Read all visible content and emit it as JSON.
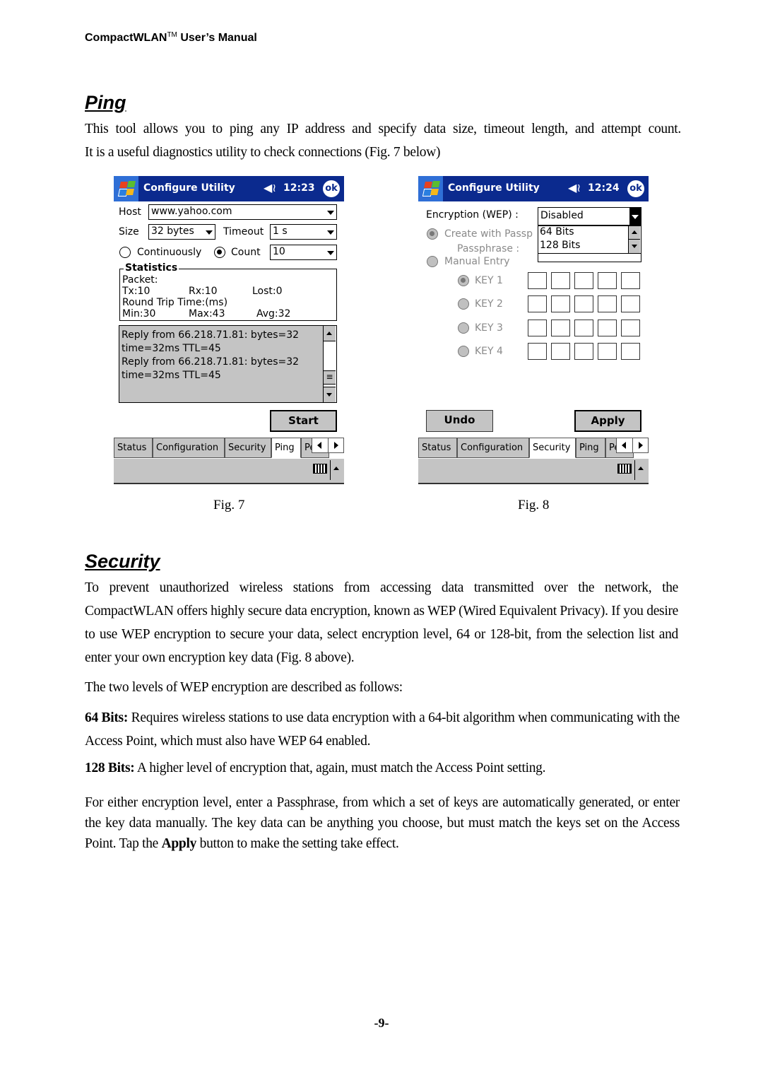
{
  "header": {
    "running_title": "CompactWLAN",
    "trademark": "TM",
    "running_title_suffix": " User’s Manual"
  },
  "ping_section": {
    "title": "Ping",
    "intro_line1": "This tool allows you to ping any IP address and specify data size, timeout length, and attempt count.",
    "intro_line2": "It is a useful diagnostics utility to check connections (Fig. 7 below)"
  },
  "fig7": {
    "caption": "Fig. 7",
    "titlebar": {
      "title": "Configure Utility",
      "time": "12:23",
      "ok_label": "ok",
      "speaker_icon": "speaker-icon"
    },
    "host_label": "Host",
    "host_value": "www.yahoo.com",
    "size_label": "Size",
    "size_value": "32 bytes",
    "timeout_label": "Timeout",
    "timeout_value": "1 s",
    "continuously_label": "Continuously",
    "continuously_selected": false,
    "count_label": "Count",
    "count_selected": true,
    "count_value": "10",
    "statistics": {
      "legend": "Statistics",
      "packet_label": "Packet:",
      "tx": "Tx:10",
      "rx": "Rx:10",
      "lost": "Lost:0",
      "rtt_label": "Round Trip Time:(ms)",
      "min": "Min:30",
      "max": "Max:43",
      "avg": "Avg:32"
    },
    "log_lines": [
      "Reply from 66.218.71.81: bytes=32",
      "time=32ms TTL=45",
      "Reply from 66.218.71.81: bytes=32",
      "time=32ms TTL=45"
    ],
    "start_button": "Start",
    "tabs": [
      {
        "label": "Status",
        "active": false
      },
      {
        "label": "Configuration",
        "active": false
      },
      {
        "label": "Security",
        "active": false
      },
      {
        "label": "Ping",
        "active": true
      },
      {
        "label": "Pe",
        "active": false
      }
    ]
  },
  "fig8": {
    "caption": "Fig. 8",
    "titlebar": {
      "title": "Configure Utility",
      "time": "12:24",
      "ok_label": "ok",
      "speaker_icon": "speaker-icon"
    },
    "encryption_label": "Encryption (WEP) :",
    "encryption_value": "Disabled",
    "encryption_options": [
      "64 Bits",
      "128 Bits"
    ],
    "create_with_passphrase_label": "Create with Passp",
    "passphrase_label": "Passphrase :",
    "manual_entry_label": "Manual Entry",
    "keys": [
      {
        "label": "KEY 1",
        "selected": true
      },
      {
        "label": "KEY 2",
        "selected": false
      },
      {
        "label": "KEY 3",
        "selected": false
      },
      {
        "label": "KEY 4",
        "selected": false
      }
    ],
    "undo_button": "Undo",
    "apply_button": "Apply",
    "tabs": [
      {
        "label": "Status",
        "active": false
      },
      {
        "label": "Configuration",
        "active": false
      },
      {
        "label": "Security",
        "active": true
      },
      {
        "label": "Ping",
        "active": false
      },
      {
        "label": "Pe",
        "active": false
      }
    ]
  },
  "security_section": {
    "title": "Security",
    "para1": "To prevent unauthorized wireless stations from accessing data transmitted over the network, the CompactWLAN offers highly secure data encryption, known as WEP (Wired Equivalent Privacy).   If you desire to use WEP encryption to secure your data, select encryption level, 64 or 128-bit, from the selection list and enter your own encryption key data (Fig. 8 above).",
    "para2": "The two levels of WEP encryption are described as follows:",
    "bits64_term": "64 Bits:",
    "bits64_desc": " Requires wireless stations to use data encryption with a 64-bit algorithm when communicating with the Access Point, which must also have WEP 64 enabled.",
    "bits128_term": "128 Bits:",
    "bits128_desc": " A higher level of encryption that, again, must match the Access Point setting.",
    "para_final_pre": "For either encryption level, enter a Passphrase, from which a set of keys are automatically generated, or enter the key data manually.  The key data can be anything you choose, but must match the keys set on the Access Point.  Tap the ",
    "para_final_bold": "Apply",
    "para_final_post": " button to make the setting take effect."
  },
  "footer": {
    "page_number": "-9-"
  }
}
